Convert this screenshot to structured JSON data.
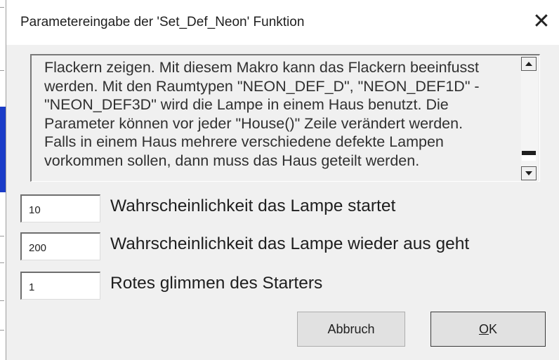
{
  "dialog": {
    "title": "Parametereingabe der 'Set_Def_Neon' Funktion",
    "close_icon": "close-icon"
  },
  "description": {
    "lines": [
      "Flackern zeigen. Mit diesem Makro kann das Flackern beeinfusst",
      "werden. Mit den Raumtypen \"NEON_DEF_D\", \"NEON_DEF1D\" -",
      "\"NEON_DEF3D\" wird die Lampe in einem Haus benutzt. Die",
      "Parameter können vor jeder \"House()\" Zeile verändert werden.",
      "Falls in einem Haus mehrere verschiedene defekte Lampen",
      "vorkommen sollen, dann muss das Haus geteilt werden."
    ],
    "scroll_position": 0.92
  },
  "params": [
    {
      "value": "10",
      "label": "Wahrscheinlichkeit das Lampe startet"
    },
    {
      "value": "200",
      "label": "Wahrscheinlichkeit das Lampe wieder aus geht"
    },
    {
      "value": "1",
      "label": "Rotes glimmen des Starters"
    }
  ],
  "buttons": {
    "cancel": "Abbruch",
    "ok_accel": "O",
    "ok_rest": "K"
  }
}
